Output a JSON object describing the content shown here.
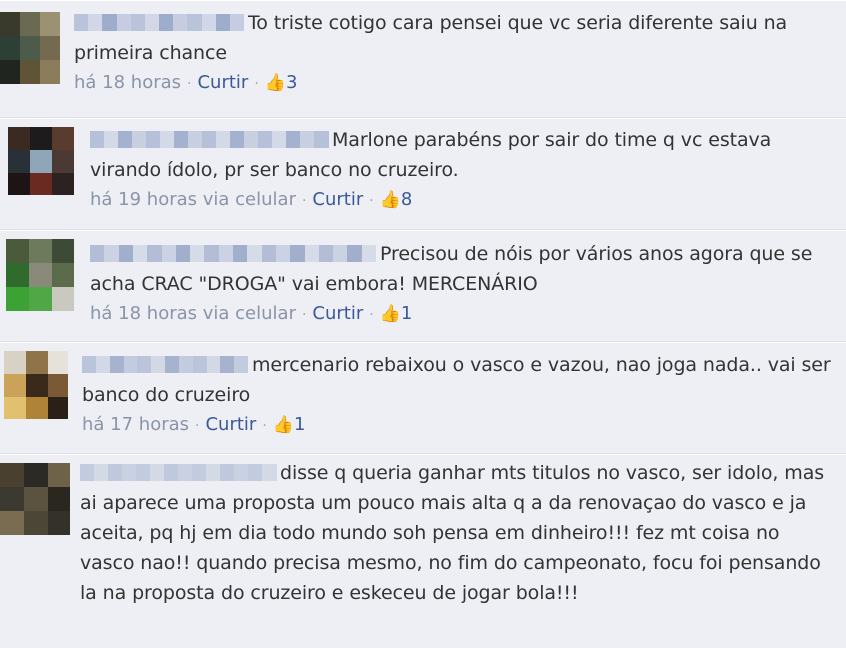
{
  "comments": [
    {
      "text": "To triste cotigo cara pensei que vc seria diferente saiu na primeira chance",
      "time": "há 18 horas",
      "via": "",
      "like_label": "Curtir",
      "likes": "3",
      "avatar_colors": [
        "#3a3a2c",
        "#6a6a52",
        "#9b9274",
        "#2e3f35",
        "#4d5b4a",
        "#736a4f",
        "#20261f",
        "#5f5437",
        "#8b7d5b"
      ],
      "name_colors": [
        "#b9c3da",
        "#d1d7e6",
        "#9fadcc",
        "#c6cde0"
      ]
    },
    {
      "text": "Marlone parabéns por sair do time q vc estava virando ídolo, pr ser banco no cruzeiro.",
      "time": "há 19 horas",
      "via": "via celular",
      "like_label": "Curtir",
      "likes": "8",
      "avatar_colors": [
        "#3b2a22",
        "#1e1b1c",
        "#5a3c2e",
        "#2a3038",
        "#8ea6b8",
        "#4b3a33",
        "#1d1515",
        "#6a2a22",
        "#2c2222"
      ],
      "name_colors": [
        "#b6c0d8",
        "#d4d9e7",
        "#a4b2cf",
        "#c8cfe1"
      ]
    },
    {
      "text": "Precisou de nóis por vários anos agora que se acha CRAC \"DROGA\" vai embora! MERCENÁRIO",
      "time": "há 18 horas",
      "via": "via celular",
      "like_label": "Curtir",
      "likes": "1",
      "avatar_colors": [
        "#4b5a3a",
        "#6e7a5c",
        "#3d4a35",
        "#2f6b2c",
        "#8a8a7a",
        "#5b6b4b",
        "#3ca235",
        "#4fa845",
        "#c9c9bf"
      ],
      "name_colors": [
        "#b3bdd6",
        "#cbd2e3",
        "#a2afcc",
        "#d6dbe8"
      ]
    },
    {
      "text": "mercenario rebaixou o vasco e vazou, nao joga nada.. vai ser banco do cruzeiro",
      "time": "há 17 horas",
      "via": "",
      "like_label": "Curtir",
      "likes": "1",
      "avatar_colors": [
        "#d8d2c4",
        "#8e7448",
        "#e6e2da",
        "#caa25a",
        "#3a2a1c",
        "#7a5a36",
        "#e1c070",
        "#b08438",
        "#2a2018"
      ],
      "name_colors": [
        "#bac4da",
        "#d2d8e6",
        "#a6b3cf",
        "#c3cbdf"
      ]
    },
    {
      "text": "disse q queria ganhar mts titulos no vasco, ser idolo, mas ai aparece uma proposta um pouco mais alta q a da renovaçao do vasco e ja aceita, pq hj em dia todo mundo soh pensa em dinheiro!!! fez mt coisa no vasco nao!! quando precisa mesmo, no fim do campeonato, focu foi pensando la na proposta do cruzeiro e eskeceu de jogar bola!!!",
      "time": "",
      "via": "",
      "like_label": "",
      "likes": "",
      "avatar_colors": [
        "#4a4030",
        "#2c2a24",
        "#6e6248",
        "#3c3a30",
        "#5c5240",
        "#2a2620",
        "#7a6c50",
        "#4c4636",
        "#34302a"
      ],
      "name_colors": [
        "#c3cbdf",
        "#d4d9e6",
        "#bfc8dc",
        "#cad1e2"
      ]
    }
  ]
}
